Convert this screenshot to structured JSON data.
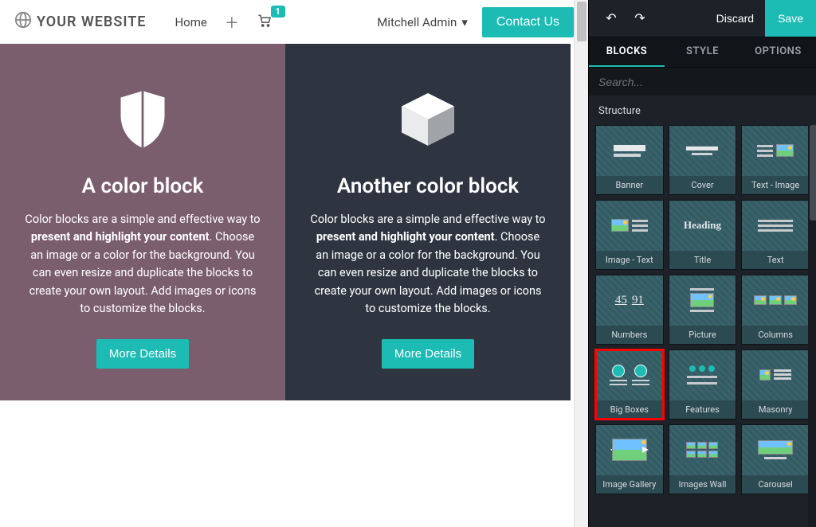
{
  "header": {
    "brand": "YOUR WEBSITE",
    "nav_home": "Home",
    "user": "Mitchell Admin",
    "contact": "Contact Us",
    "cart_count": "1"
  },
  "blocks": {
    "left": {
      "title": "A color block",
      "desc_pre": "Color blocks are a simple and effective way to ",
      "desc_bold": "present and highlight your content",
      "desc_post": ". Choose an image or a color for the background. You can even resize and duplicate the blocks to create your own layout. Add images or icons to customize the blocks.",
      "button": "More Details"
    },
    "right": {
      "title": "Another color block",
      "desc_pre": "Color blocks are a simple and effective way to ",
      "desc_bold": "present and highlight your content",
      "desc_post": ". Choose an image or a color for the background. You can even resize and duplicate the blocks to create your own layout. Add images or icons to customize the blocks.",
      "button": "More Details"
    }
  },
  "editor": {
    "discard": "Discard",
    "save": "Save",
    "tabs": {
      "blocks": "BLOCKS",
      "style": "STYLE",
      "options": "OPTIONS"
    },
    "search_placeholder": "Search...",
    "structure": "Structure",
    "snippets": [
      "Banner",
      "Cover",
      "Text - Image",
      "Image - Text",
      "Title",
      "Text",
      "Numbers",
      "Picture",
      "Columns",
      "Big Boxes",
      "Features",
      "Masonry",
      "Image Gallery",
      "Images Wall",
      "Carousel"
    ]
  }
}
